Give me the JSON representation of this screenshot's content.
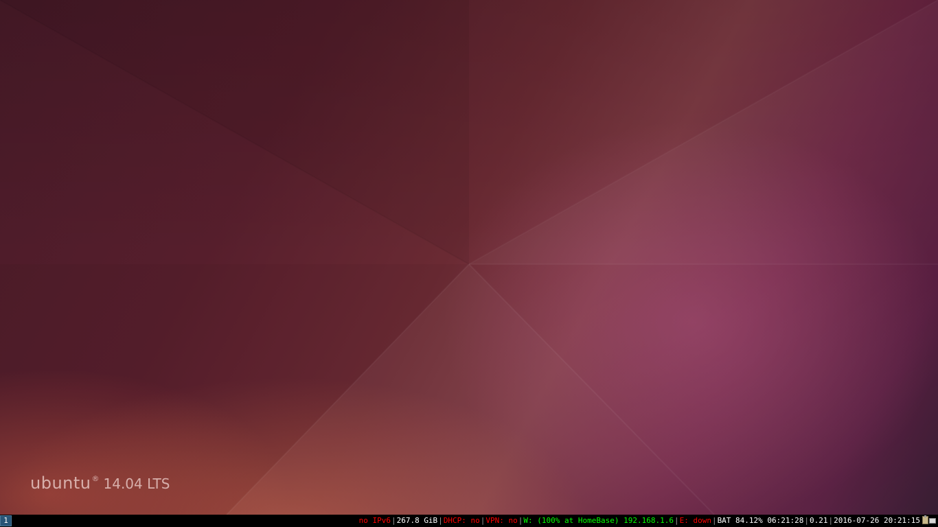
{
  "desktop": {
    "logo": {
      "wordmark": "ubuntu",
      "mark": "®",
      "version": "14.04 LTS"
    }
  },
  "statusbar": {
    "workspace": "1",
    "items": {
      "ipv6": "no IPv6",
      "disk": "267.8 GiB",
      "dhcp": "DHCP: no",
      "vpn": "VPN: no",
      "wireless": "W: (100% at HomeBase) 192.168.1.6",
      "ethernet": "E: down",
      "battery": "BAT 84.12% 06:21:28",
      "load": "0.21",
      "datetime": "2016-07-26 20:21:15"
    },
    "colors": {
      "bad": "#ff0000",
      "good": "#00ff00",
      "neutral": "#ffffff",
      "separator": "#999999",
      "workspace_bg": "#285577"
    },
    "tray_icons": [
      "clipboard-icon",
      "keyboard-icon"
    ]
  }
}
